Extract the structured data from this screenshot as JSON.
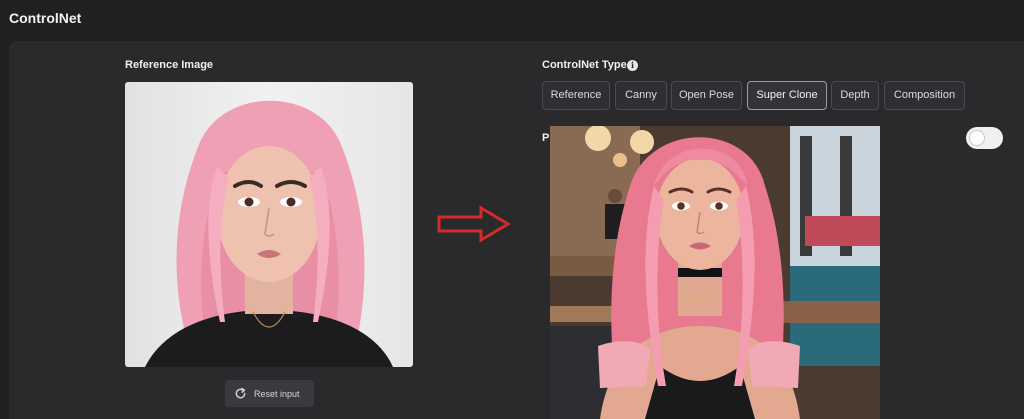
{
  "app": {
    "title": "ControlNet"
  },
  "reference": {
    "label": "Reference Image",
    "image_alt": "Portrait of a woman with long pink hair and a black top",
    "reset_label": "Reset input",
    "reset_icon": "refresh-icon"
  },
  "controlnet": {
    "label": "ControlNet Type",
    "info_icon": "info-icon",
    "types": [
      "Reference",
      "Canny",
      "Open Pose",
      "Super Clone",
      "Depth",
      "Composition"
    ],
    "selected": "Super Clone"
  },
  "preview": {
    "partial_label": "P",
    "toggle_state": "on",
    "image_alt": "Generated image of a woman with pink hair seated in a cafe, off-shoulder pink top and black choker"
  },
  "arrow": {
    "icon": "arrow-right-icon",
    "color": "#d42a2a"
  },
  "colors": {
    "background": "#202022",
    "panel": "#2a2a2d",
    "button": "#2f2f33",
    "button_border": "#4a4a4f",
    "active_border": "#9c9ca2",
    "hair_pink": "#f0a0b4"
  }
}
